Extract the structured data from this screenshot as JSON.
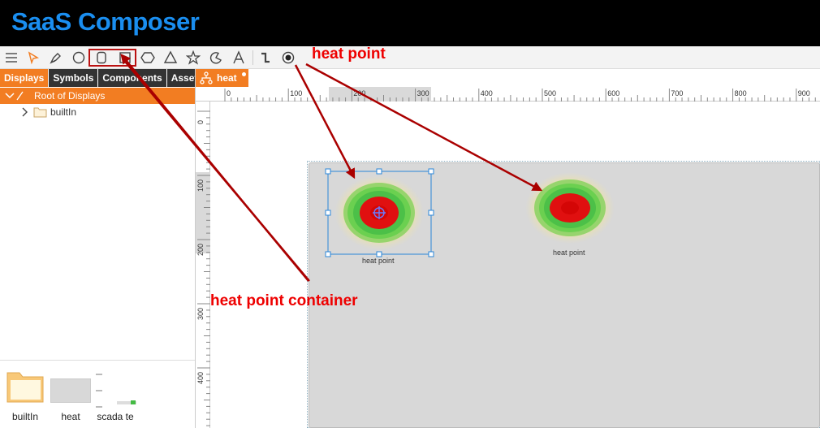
{
  "app": {
    "title": "SaaS Composer"
  },
  "toolbar": {
    "icons": [
      "menu-icon",
      "pointer-icon",
      "pen-icon",
      "circle-icon",
      "rounded-rect-icon",
      "rect-icon",
      "hexagon-icon",
      "triangle-icon",
      "star-icon",
      "arc-icon",
      "text-icon",
      "connector-icon",
      "heat-point-icon"
    ]
  },
  "annotations": {
    "heat_point": "heat point",
    "heat_point_container": "heat point container"
  },
  "sidebar": {
    "tabs": [
      "Displays",
      "Symbols",
      "Components",
      "Assets"
    ],
    "root_label": "Root of Displays",
    "tree": [
      {
        "label": "builtIn"
      }
    ],
    "thumbnails": [
      {
        "label": "builtIn"
      },
      {
        "label": "heat"
      },
      {
        "label": "scada te"
      }
    ]
  },
  "editor": {
    "file_tab": "heat",
    "ruler_x_labels": [
      "0",
      "100",
      "200",
      "300",
      "400",
      "500",
      "600",
      "700",
      "800",
      "900"
    ],
    "ruler_y_labels": [
      "0",
      "100",
      "200",
      "300",
      "400"
    ],
    "heat_points": [
      {
        "label": "heat point"
      },
      {
        "label": "heat point"
      }
    ]
  },
  "colors": {
    "accent": "#f27d22",
    "brand": "#1a8ef0",
    "annotation": "#ee0000",
    "arrow": "#aa0000"
  }
}
